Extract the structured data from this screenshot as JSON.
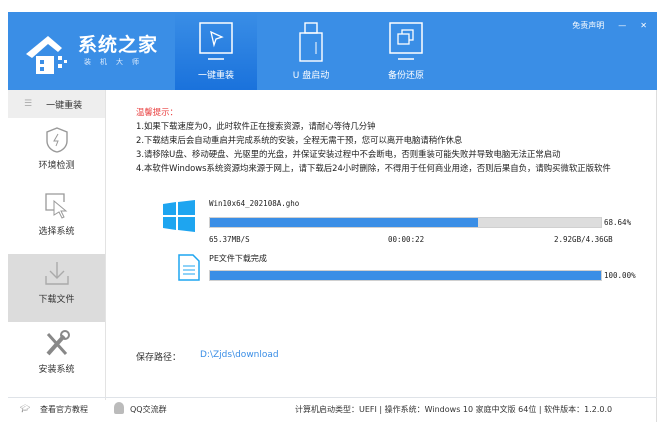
{
  "header": {
    "brand": "系统之家",
    "subtitle": "装机大师",
    "disclaimer": "免责声明",
    "minimize": "—",
    "close": "✕",
    "tabs": [
      {
        "label": "一键重装",
        "icon": "cursor-monitor-icon"
      },
      {
        "label": "U 盘启动",
        "icon": "usb-icon"
      },
      {
        "label": "备份还原",
        "icon": "backup-icon"
      }
    ]
  },
  "sidebar": {
    "header": "一键重装",
    "items": [
      {
        "label": "环境检测",
        "icon": "shield-icon"
      },
      {
        "label": "选择系统",
        "icon": "cursor-icon"
      },
      {
        "label": "下载文件",
        "icon": "download-icon"
      },
      {
        "label": "安装系统",
        "icon": "tools-icon"
      }
    ]
  },
  "tips": {
    "title": "温馨提示：",
    "lines": [
      "1.如果下载速度为0，此时软件正在搜索资源，请耐心等待几分钟",
      "2.下载结束后会自动重启并完成系统的安装，全程无需干预，您可以离开电脑请稍作休息",
      "3.请移除U盘、移动硬盘、光驱里的光盘，并保证安装过程中不会断电，否则重装可能失败并导致电脑无法正常启动",
      "4.本软件Windows系统资源均来源于网上，请下载后24小时删除，不得用于任何商业用途，否则后果自负，请购买微软正版软件"
    ]
  },
  "downloads": [
    {
      "name": "Win10x64_202108A.gho",
      "progress": 68.64,
      "percent": "68.64%",
      "speed": "65.37MB/S",
      "elapsed": "00:00:22",
      "size": "2.92GB/4.36GB"
    },
    {
      "name": "PE文件下载完成",
      "progress": 100,
      "percent": "100.00%"
    }
  ],
  "save": {
    "label": "保存路径：",
    "path": "D:\\Zjds\\download"
  },
  "footer": {
    "tutorial": "查看官方教程",
    "qq": "QQ交流群",
    "status": "计算机启动类型：UEFI | 操作系统：Windows 10 家庭中文版 64位 | 软件版本：1.2.0.0"
  }
}
